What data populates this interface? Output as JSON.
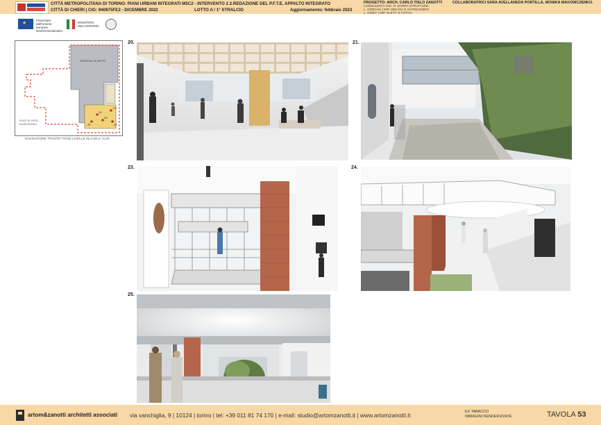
{
  "header": {
    "title_line1": "CITTÀ METROPOLITANA DI TORINO: PIANI URBANI INTEGRATI M5C2 - INTERVENTO 2.2.REDAZIONE DEL P.F.T.E. APPALTO INTEGRATO",
    "title_line2": "CITTÀ DI CHIERI | CIG: 940875FE2 - DICEMBRE 2022",
    "lotto": "LOTTO A / 1° STRALCIO",
    "aggiornamento": "Aggiornamento: febbraio 2023",
    "progetto": "PROGETTO: ARCH. CARLO ITALO ZANOTTI",
    "consulenti": [
      "CONSULENTI: ING. N. BARRA STRUTTURE",
      "L. GOBCHU | IMP. MECAN. E ANTINCENDIO",
      "L. GOBIT | IMP. ELETT. E FOTOV."
    ],
    "collaboratrici": "COLLABORATRICI SARA AVELLANEDA PORTILLA, MONIKA MAKOWCZENKO."
  },
  "funding": {
    "eu_text": [
      "Finanziato",
      "dall'Unione europea",
      "NextGenerationEU"
    ],
    "ministero_text": [
      "MINISTERO",
      "DELL'INTERNO"
    ]
  },
  "keyplan": {
    "building_label": "EDIFICIO OLIVETTI",
    "points_label": [
      "PUNTI DI VISTA",
      "Da Alto Rendere"
    ],
    "caption": "NAVIGATORE \"PIANTE\" PIANI LIVELLE  da 2:00 a +5:20",
    "viewpoints": [
      "20",
      "21",
      "23",
      "24",
      "25"
    ]
  },
  "panels": [
    {
      "number": "20."
    },
    {
      "number": "21."
    },
    {
      "number": "23."
    },
    {
      "number": "24."
    },
    {
      "number": "25."
    }
  ],
  "footer": {
    "firm_name": "artom&zanotti architetti associati",
    "address": "via vanchiglia, 9 | 10124 | torino | tel: +39 011 81 74 170 | e-mail: studio@artomzanotti.it | www.artomzanotti.it",
    "project_line1": "EX TABACCO",
    "project_line2": "IMMAGINI RENDERIZZATE",
    "tavola_label": "TAVOLA",
    "tavola_number": "53"
  },
  "colors": {
    "band": "#f7d8a6",
    "brick": "#b4654a",
    "redline": "#d94a3a"
  }
}
